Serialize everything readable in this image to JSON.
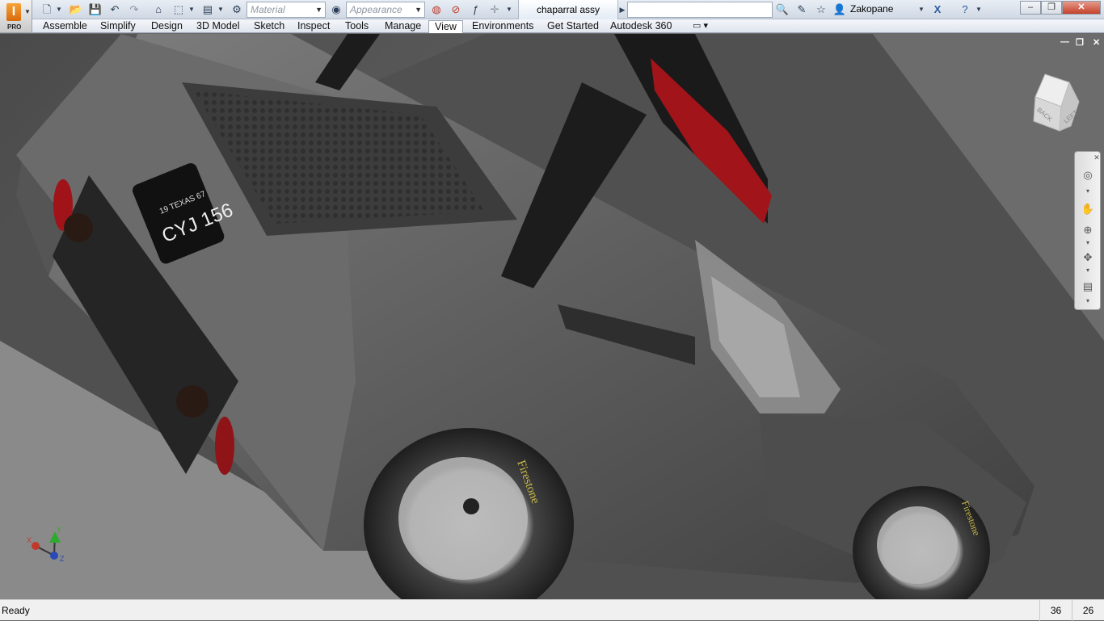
{
  "app": {
    "title": "chaparral assy",
    "edition_label": "PRO"
  },
  "qat": {
    "material_placeholder": "Material",
    "appearance_placeholder": "Appearance",
    "search_value": "",
    "user_name": "Zakopane"
  },
  "ribbon": {
    "tabs": [
      {
        "label": "Assemble"
      },
      {
        "label": "Simplify"
      },
      {
        "label": "Design"
      },
      {
        "label": "3D Model"
      },
      {
        "label": "Sketch"
      },
      {
        "label": "Inspect"
      },
      {
        "label": "Tools"
      },
      {
        "label": "Manage"
      },
      {
        "label": "View"
      },
      {
        "label": "Environments"
      },
      {
        "label": "Get Started"
      },
      {
        "label": "Autodesk 360"
      }
    ],
    "active_tab": "View"
  },
  "viewcube": {
    "face_back": "BACK",
    "face_left": "LEFT"
  },
  "model": {
    "plate_top": "19 TEXAS 67",
    "plate_number": "CYJ 156",
    "tire_brand": "Firestone"
  },
  "triad": {
    "x_label": "X",
    "y_label": "Y",
    "z_label": "Z"
  },
  "status": {
    "text": "Ready",
    "count_a": "36",
    "count_b": "26"
  },
  "colors": {
    "accent": "#2c5aa0",
    "car_body": "#5a5a5a",
    "wing_red": "#a0141a",
    "background": "#6a6a6a"
  }
}
